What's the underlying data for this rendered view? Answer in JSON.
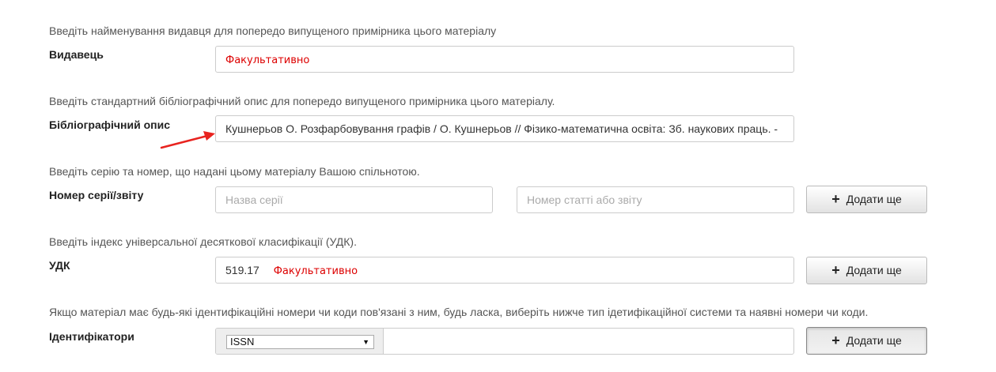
{
  "publisher": {
    "hint": "Введіть найменування видавця для попередо випущеного примірника цього матеріалу",
    "label": "Видавець",
    "placeholder": "Факультативно"
  },
  "citation": {
    "hint": "Введіть стандартний бібліографічний опис для попередо випущеного примірника цього матеріалу.",
    "label": "Бібліографічний опис",
    "value": "Кушнерьов О. Розфарбовування графів / О. Кушнерьов // Фізико-математична освіта: Зб. наукових праць. -"
  },
  "series": {
    "hint": "Введіть серію та номер, що надані цьому матеріалу Вашою спільнотою.",
    "label": "Номер серії/звіту",
    "series_placeholder": "Назва серії",
    "number_placeholder": "Номер статті або звіту",
    "add_label": "Додати ще"
  },
  "udc": {
    "hint": "Введіть індекс універсальної десяткової класифікації (УДК).",
    "label": "УДК",
    "value": "519.17",
    "optional": "Факультативно",
    "add_label": "Додати ще"
  },
  "identifiers": {
    "hint": "Якщо матеріал має будь-які ідентифікаційні номери чи коди пов'язані з ним, будь ласка, виберіть нижче тип ідетифікаційної системи та наявні номери чи коди.",
    "label": "Ідентифікатори",
    "selected_type": "ISSN",
    "value": "",
    "add_label": "Додати ще"
  },
  "icons": {
    "add": "plus-icon",
    "dropdown": "caret-down-icon",
    "annotation": "red-arrow"
  },
  "colors": {
    "optional_text": "#dd0000",
    "annotation_arrow": "#e8231f"
  }
}
